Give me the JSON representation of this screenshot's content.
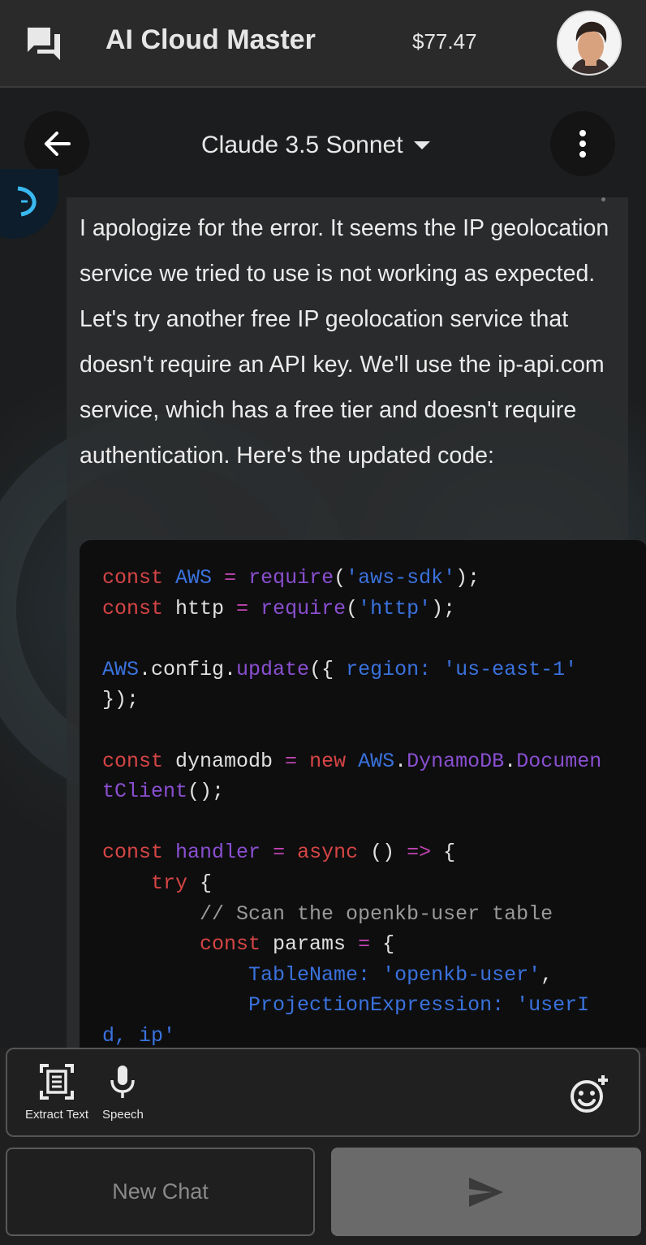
{
  "header": {
    "title": "AI Cloud Master",
    "balance": "$77.47",
    "icons": {
      "chats": "forum-icon",
      "avatar": "user-avatar"
    }
  },
  "model_bar": {
    "model_name": "Claude 3.5 Sonnet",
    "icons": {
      "back": "arrow-left-icon",
      "dropdown": "caret-down-icon",
      "more": "more-vertical-icon"
    }
  },
  "message": {
    "text": "I apologize for the error. It seems the IP geolocation service we tried to use is not working as expected. Let's try another free IP geolocation service that doesn't require an API key. We'll use the ip-api.com service, which has a free tier and doesn't require authentication. Here's the updated code:",
    "code_lines": [
      "const AWS = require('aws-sdk');",
      "const http = require('http');",
      "",
      "AWS.config.update({ region: 'us-east-1'",
      "});",
      "",
      "const dynamodb = new AWS.DynamoDB.Documen",
      "tClient();",
      "",
      "const handler = async () => {",
      "    try {",
      "        // Scan the openkb-user table",
      "        const params = {",
      "            TableName: 'openkb-user',",
      "            ProjectionExpression: 'userI",
      "d, ip'"
    ]
  },
  "toolbar": {
    "extract_text_label": "Extract Text",
    "speech_label": "Speech",
    "icons": {
      "extract": "document-scan-icon",
      "speech": "microphone-icon",
      "emoji": "add-emoji-icon"
    }
  },
  "actions": {
    "new_chat_label": "New Chat",
    "icons": {
      "send": "send-icon"
    }
  },
  "colors": {
    "keyword": "#d64545",
    "operator": "#c044b0",
    "function": "#8a4fd0",
    "string": "#3a72dd",
    "comment": "#9a9a9a",
    "send_button": "#6a6a6a"
  }
}
